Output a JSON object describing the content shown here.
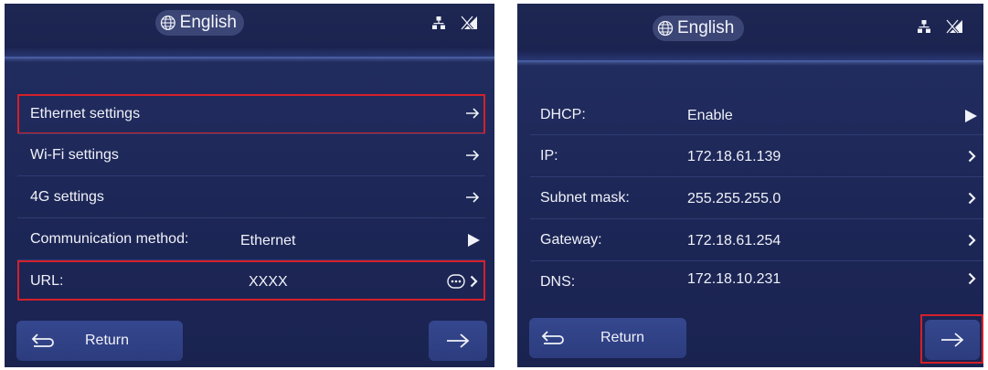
{
  "left_screen": {
    "language": "English",
    "menu": [
      {
        "label": "Ethernet settings"
      },
      {
        "label": "Wi-Fi settings"
      },
      {
        "label": "4G settings"
      }
    ],
    "communication": {
      "label": "Communication method:",
      "value": "Ethernet"
    },
    "url": {
      "label": "URL:",
      "value": "XXXX"
    },
    "return_label": "Return"
  },
  "right_screen": {
    "language": "English",
    "fields": [
      {
        "label": "DHCP:",
        "value": "Enable"
      },
      {
        "label": "IP:",
        "value": "172.18.61.139"
      },
      {
        "label": "Subnet mask:",
        "value": "255.255.255.0"
      },
      {
        "label": "Gateway:",
        "value": "172.18.61.254"
      },
      {
        "label": "DNS:",
        "value": "172.18.10.231"
      }
    ],
    "return_label": "Return"
  },
  "colors": {
    "background": "#1d2757",
    "highlight": "#d4202a",
    "button": "#2f4083"
  }
}
